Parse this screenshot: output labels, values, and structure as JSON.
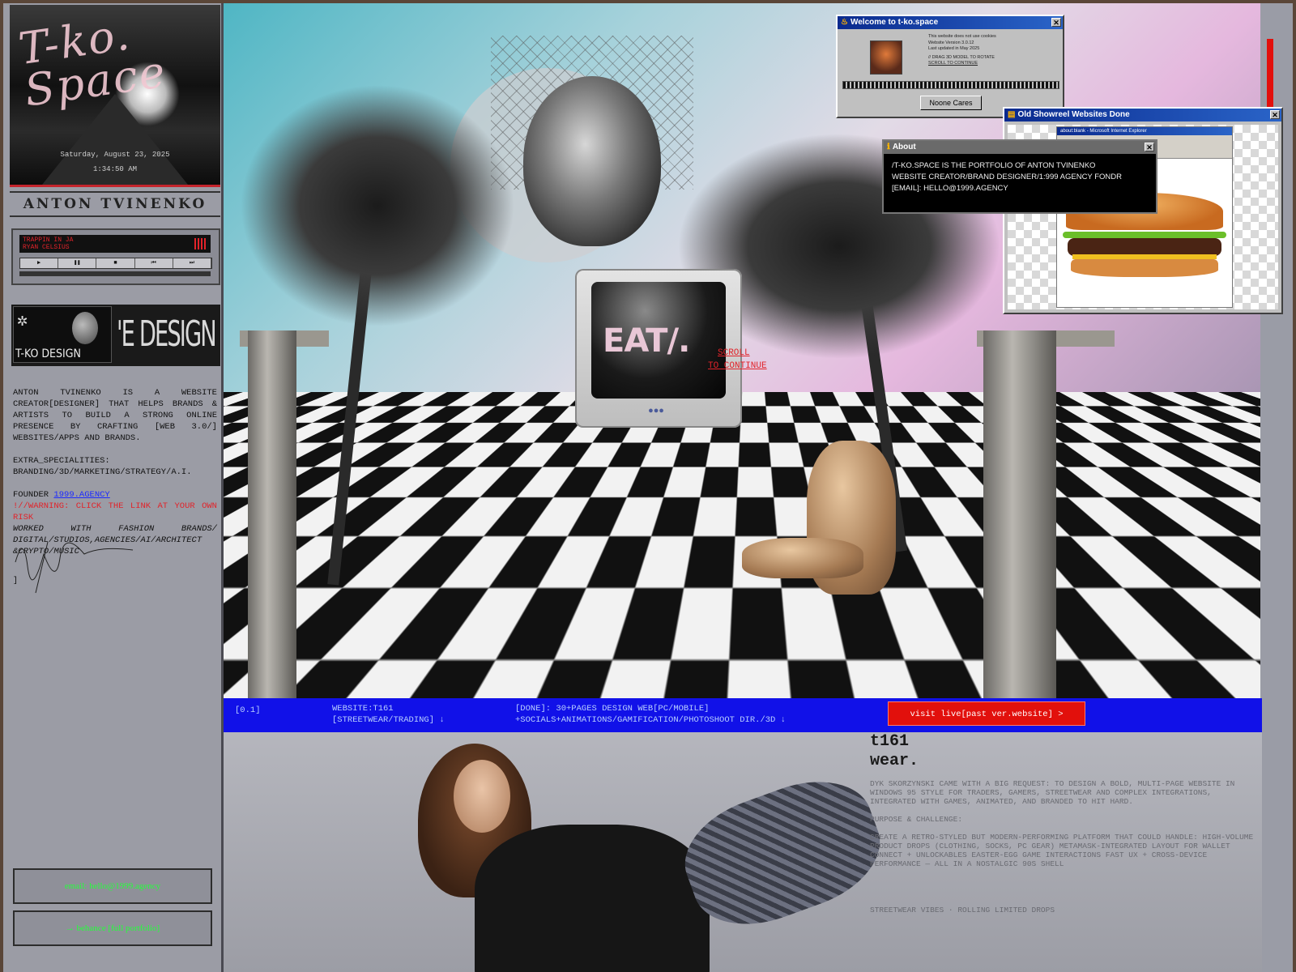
{
  "sidebar": {
    "hero": {
      "logo_text": "T-ko. Space",
      "date": "Saturday, August 23, 2025",
      "time": "1:34:50 AM"
    },
    "name": "ANTON TVINENKO",
    "player": {
      "track_line1": "TRAPPIN IN JA",
      "track_line2": "RYAN CELSIUS",
      "controls": [
        "▶",
        "❚❚",
        "■",
        "⏮",
        "⏭"
      ]
    },
    "banner": {
      "thumb_label": "T-KO DESIGN",
      "big_text": "'E DESIGN +DEV"
    },
    "bio": "ANTON TVINENKO IS A WEBSITE CREATOR[DESIGNER] THAT HELPS BRANDS & ARTISTS TO BUILD A STRONG ONLINE PRESENCE BY CRAFTING [WEB 3.0/] WEBSITES/APPS AND BRANDS.",
    "extra_label": "EXTRA_SPECIALITIES:",
    "extra_value": "BRANDING/3D/MARKETING/STRATEGY/A.I.",
    "founder_label": "FOUNDER ",
    "founder_link": "1999.AGENCY",
    "warning": "!//WARNING: CLICK THE LINK AT YOUR OWN RISK",
    "worked_with": "WORKED WITH FASHION BRANDS/ DIGITAL/STUDIOS,AGENCIES/AI/ARCHITECT &CRYPTO/MUSIC",
    "closing_bracket": "]",
    "email_button": "email: hello@1999.agency",
    "behance_button": "→ behance [full portfolio]"
  },
  "scene": {
    "monitor_text": "EAT/.",
    "scroll_line1": "SCROLL",
    "scroll_line2": "TO CONTINUE"
  },
  "windows": {
    "welcome": {
      "title": "Welcome to t-ko.space",
      "line1": "This website does not use cookies",
      "line2": "Website Version 3.0.12",
      "line3": "Last updated in May 2025",
      "line4": "// DRAG 3D MODEL TO ROTATE",
      "line5": "SCROLL TO CONTINUE",
      "button": "Noone Cares"
    },
    "showreel": {
      "title": "Old Showreel Websites Done",
      "ie_title": "about:blank - Microsoft Internet Explorer"
    },
    "about": {
      "title": "About",
      "line1": "/T-KO.SPACE IS THE PORTFOLIO OF ANTON TVINENKO",
      "line2": "WEBSITE CREATOR/BRAND DESIGNER/1:999 AGENCY FONDR",
      "line3": "[EMAIL]: HELLO@1999.AGENCY"
    }
  },
  "project_bar": {
    "index": "[0.1]",
    "website_line1": "WEBSITE:T161",
    "website_line2": "[STREETWEAR/TRADING] ↓",
    "done_line1": "[DONE]: 30+PAGES DESIGN WEB[PC/MOBILE]",
    "done_line2": "+SOCIALS+ANIMATIONS/GAMIFICATION/PHOTOSHOOT DIR./3D ↓",
    "visit_button": "visit live[past ver.website] >"
  },
  "project": {
    "title_line1": "t161",
    "title_line2": "wear.",
    "desc1": "DYK SKORZYNSKI CAME WITH A BIG REQUEST: TO DESIGN A BOLD, MULTI-PAGE WEBSITE IN WINDOWS 95 STYLE FOR TRADERS, GAMERS, STREETWEAR AND COMPLEX INTEGRATIONS, INTEGRATED WITH GAMES, ANIMATED, AND BRANDED TO HIT HARD.",
    "desc2": "PURPOSE & CHALLENGE:",
    "desc3": "CREATE A RETRO-STYLED BUT MODERN-PERFORMING PLATFORM THAT COULD HANDLE: HIGH-VOLUME PRODUCT DROPS (CLOTHING, SOCKS, PC GEAR) METAMASK-INTEGRATED LAYOUT FOR WALLET CONNECT + UNLOCKABLES EASTER-EGG GAME INTERACTIONS FAST UX + CROSS-DEVICE PERFORMANCE — ALL IN A NOSTALGIC 90S SHELL",
    "desc4": "STREETWEAR VIBES · ROLLING LIMITED DROPS"
  }
}
